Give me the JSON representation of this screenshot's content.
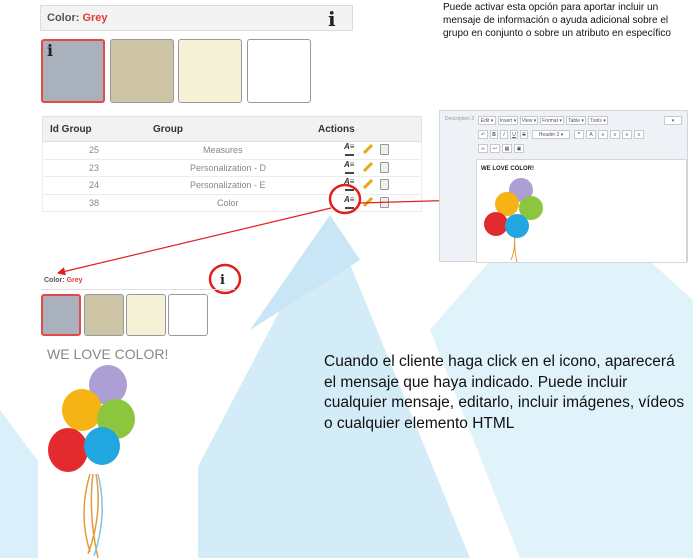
{
  "top_selector": {
    "label": "Color:",
    "value": "Grey",
    "info_icon": "i"
  },
  "swatches": [
    {
      "name": "grey",
      "color": "#a9b1bd",
      "selected": true
    },
    {
      "name": "beige",
      "color": "#cdc4a5",
      "selected": false
    },
    {
      "name": "cream",
      "color": "#f4f1d6",
      "selected": false
    },
    {
      "name": "white",
      "color": "#ffffff",
      "selected": false
    }
  ],
  "callout_top": "Puede activar esta opción para aportar incluir un mensaje de información o ayuda adicional sobre el grupo en conjunto o sobre un atributo en específico",
  "table": {
    "headers": {
      "id": "Id Group",
      "group": "Group",
      "actions": "Actions"
    },
    "rows": [
      {
        "id": "25",
        "group": "Measures"
      },
      {
        "id": "23",
        "group": "Personalization - D"
      },
      {
        "id": "24",
        "group": "Personalization - E"
      },
      {
        "id": "38",
        "group": "Color"
      }
    ]
  },
  "editor": {
    "side_label": "Description 2",
    "menus": [
      "Edit ▾",
      "Insert ▾",
      "View ▾",
      "Format ▾",
      "Table ▾",
      "Tools ▾"
    ],
    "format_buttons": [
      "B",
      "I",
      "U",
      "S",
      "Header 2 ▾"
    ],
    "content": "WE LOVE COLOR!"
  },
  "preview": {
    "label": "Color:",
    "value": "Grey",
    "info_icon": "i",
    "message": "WE LOVE COLOR!"
  },
  "callout_bottom": "Cuando el cliente haga click en el icono, aparecerá el mensaje que haya indicado. Puede incluir cualquier mensaje, editarlo, incluir imágenes, vídeos o cualquier elemento HTML",
  "colors": {
    "accent_red": "#e0201f",
    "background_shape": "#cfe9f6"
  }
}
